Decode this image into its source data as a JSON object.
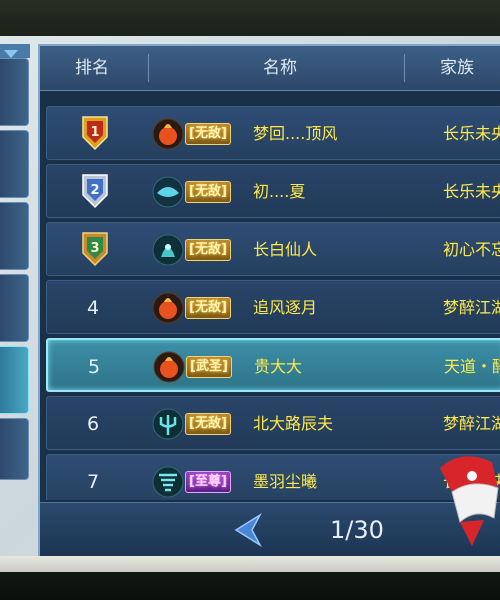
{
  "header": {
    "rank": "排名",
    "name": "名称",
    "family": "家族"
  },
  "rows": [
    {
      "rank": "1",
      "badge": "gold-shield",
      "icon": "fire-orb-icon",
      "tag": "[无敌]",
      "tag_color": "gold",
      "name": "梦回....顶风",
      "family": "长乐未央"
    },
    {
      "rank": "2",
      "badge": "silver-shield",
      "icon": "ice-fish-icon",
      "tag": "[无敌]",
      "tag_color": "gold",
      "name": "初....夏",
      "family": "长乐未央"
    },
    {
      "rank": "3",
      "badge": "bronze-shield",
      "icon": "spirit-icon",
      "tag": "[无敌]",
      "tag_color": "gold",
      "name": "长白仙人",
      "family": "初心不忘"
    },
    {
      "rank": "4",
      "badge": "",
      "icon": "fire-orb-icon",
      "tag": "[无敌]",
      "tag_color": "gold",
      "name": "追风逐月",
      "family": "梦醉江湖"
    },
    {
      "rank": "5",
      "badge": "",
      "icon": "fire-orb-icon",
      "tag": "[武圣]",
      "tag_color": "gold",
      "name": "贵大大",
      "family": "天道・醉"
    },
    {
      "rank": "6",
      "badge": "",
      "icon": "trident-icon",
      "tag": "[无敌]",
      "tag_color": "gold",
      "name": "北大路辰夫",
      "family": "梦醉江湖"
    },
    {
      "rank": "7",
      "badge": "",
      "icon": "tornado-icon",
      "tag": "[至尊]",
      "tag_color": "purple",
      "name": "墨羽尘曦",
      "family": "长乐未央"
    }
  ],
  "selected_row": "5",
  "pager": {
    "page_text": "1/30"
  },
  "colors": {
    "name_text": "#ffe94a",
    "header_bg": "#3d5f86",
    "selected_row": "#3d8fa7"
  }
}
